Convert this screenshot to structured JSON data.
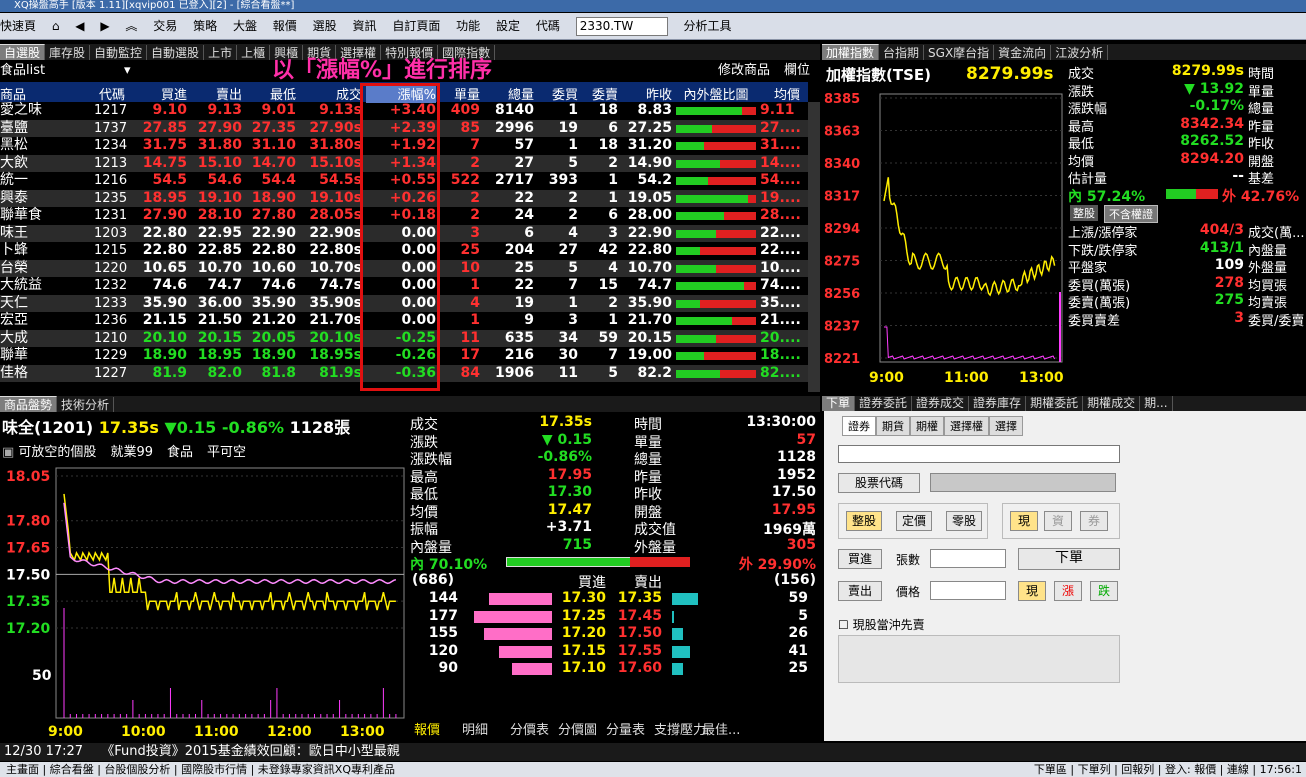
{
  "window": {
    "title": "XQ操盤高手 [版本 1.11][xqvip001 已登入][2] - [綜合看盤**]"
  },
  "toolbar": {
    "items": [
      "快速頁",
      "交易",
      "策略",
      "大盤",
      "報價",
      "選股",
      "資訊",
      "自訂頁面",
      "功能",
      "設定",
      "代碼"
    ],
    "symbol_value": "2330.TW",
    "analysis": "分析工具"
  },
  "watchlist": {
    "tabs": [
      "自選股",
      "庫存股",
      "自動監控",
      "自動選股",
      "上市",
      "上櫃",
      "興櫃",
      "期貨",
      "選擇權",
      "特別報價",
      "國際指數"
    ],
    "list_name": "食品list",
    "edit_label": "修改商品",
    "field_label": "欄位",
    "overlay_text": "以「漲幅%」進行排序",
    "columns": [
      "商品",
      "代碼",
      "買進",
      "賣出",
      "最低",
      "成交",
      "漲幅%",
      "單量",
      "總量",
      "委買",
      "委賣",
      "昨收",
      "內外盤比圖",
      "均價"
    ],
    "rows": [
      {
        "name": "愛之味",
        "code": "1217",
        "bid": "9.10",
        "ask": "9.13",
        "low": "9.01",
        "last": "9.13s",
        "chg": "+3.40",
        "vol": "409",
        "total": "8140",
        "bq": "1",
        "aq": "18",
        "prev": "8.83",
        "avg": "9.11",
        "c": "red",
        "g": 0.82
      },
      {
        "name": "臺鹽",
        "code": "1737",
        "bid": "27.85",
        "ask": "27.90",
        "low": "27.35",
        "last": "27.90s",
        "chg": "+2.39",
        "vol": "85",
        "total": "2996",
        "bq": "19",
        "aq": "6",
        "prev": "27.25",
        "avg": "27....",
        "c": "red",
        "g": 0.45
      },
      {
        "name": "黑松",
        "code": "1234",
        "bid": "31.75",
        "ask": "31.80",
        "low": "31.10",
        "last": "31.80s",
        "chg": "+1.92",
        "vol": "7",
        "total": "57",
        "bq": "1",
        "aq": "18",
        "prev": "31.20",
        "avg": "31....",
        "c": "red",
        "g": 0.35
      },
      {
        "name": "大飲",
        "code": "1213",
        "bid": "14.75",
        "ask": "15.10",
        "low": "14.70",
        "last": "15.10s",
        "chg": "+1.34",
        "vol": "2",
        "total": "27",
        "bq": "5",
        "aq": "2",
        "prev": "14.90",
        "avg": "14....",
        "c": "red",
        "g": 0.55
      },
      {
        "name": "統一",
        "code": "1216",
        "bid": "54.5",
        "ask": "54.6",
        "low": "54.4",
        "last": "54.5s",
        "chg": "+0.55",
        "vol": "522",
        "total": "2717",
        "bq": "393",
        "aq": "1",
        "prev": "54.2",
        "avg": "54....",
        "c": "red",
        "g": 0.4
      },
      {
        "name": "興泰",
        "code": "1235",
        "bid": "18.95",
        "ask": "19.10",
        "low": "18.90",
        "last": "19.10s",
        "chg": "+0.26",
        "vol": "2",
        "total": "22",
        "bq": "2",
        "aq": "1",
        "prev": "19.05",
        "avg": "19....",
        "c": "red",
        "g": 0.9
      },
      {
        "name": "聯華食",
        "code": "1231",
        "bid": "27.90",
        "ask": "28.10",
        "low": "27.80",
        "last": "28.05s",
        "chg": "+0.18",
        "vol": "2",
        "total": "24",
        "bq": "2",
        "aq": "6",
        "prev": "28.00",
        "avg": "28....",
        "c": "red",
        "g": 0.6
      },
      {
        "name": "味王",
        "code": "1203",
        "bid": "22.80",
        "ask": "22.95",
        "low": "22.90",
        "last": "22.90s",
        "chg": "0.00",
        "vol": "3",
        "total": "6",
        "bq": "4",
        "aq": "3",
        "prev": "22.90",
        "avg": "22....",
        "c": "wht",
        "g": 0.5
      },
      {
        "name": "卜蜂",
        "code": "1215",
        "bid": "22.80",
        "ask": "22.85",
        "low": "22.80",
        "last": "22.80s",
        "chg": "0.00",
        "vol": "25",
        "total": "204",
        "bq": "27",
        "aq": "42",
        "prev": "22.80",
        "avg": "22....",
        "c": "wht",
        "g": 0.3
      },
      {
        "name": "台榮",
        "code": "1220",
        "bid": "10.65",
        "ask": "10.70",
        "low": "10.60",
        "last": "10.70s",
        "chg": "0.00",
        "vol": "10",
        "total": "25",
        "bq": "5",
        "aq": "4",
        "prev": "10.70",
        "avg": "10....",
        "c": "wht",
        "g": 0.5
      },
      {
        "name": "大統益",
        "code": "1232",
        "bid": "74.6",
        "ask": "74.7",
        "low": "74.6",
        "last": "74.7s",
        "chg": "0.00",
        "vol": "1",
        "total": "22",
        "bq": "7",
        "aq": "15",
        "prev": "74.7",
        "avg": "74....",
        "c": "wht",
        "g": 0.85
      },
      {
        "name": "天仁",
        "code": "1233",
        "bid": "35.90",
        "ask": "36.00",
        "low": "35.90",
        "last": "35.90s",
        "chg": "0.00",
        "vol": "4",
        "total": "19",
        "bq": "1",
        "aq": "2",
        "prev": "35.90",
        "avg": "35....",
        "c": "wht",
        "g": 0.3
      },
      {
        "name": "宏亞",
        "code": "1236",
        "bid": "21.15",
        "ask": "21.50",
        "low": "21.20",
        "last": "21.70s",
        "chg": "0.00",
        "vol": "1",
        "total": "9",
        "bq": "3",
        "aq": "1",
        "prev": "21.70",
        "avg": "21....",
        "c": "wht",
        "g": 0.7
      },
      {
        "name": "大成",
        "code": "1210",
        "bid": "20.10",
        "ask": "20.15",
        "low": "20.05",
        "last": "20.10s",
        "chg": "-0.25",
        "vol": "11",
        "total": "635",
        "bq": "34",
        "aq": "59",
        "prev": "20.15",
        "avg": "20....",
        "c": "grn",
        "g": 0.5
      },
      {
        "name": "聯華",
        "code": "1229",
        "bid": "18.90",
        "ask": "18.95",
        "low": "18.90",
        "last": "18.95s",
        "chg": "-0.26",
        "vol": "17",
        "total": "216",
        "bq": "30",
        "aq": "7",
        "prev": "19.00",
        "avg": "18....",
        "c": "grn",
        "g": 0.35
      },
      {
        "name": "佳格",
        "code": "1227",
        "bid": "81.9",
        "ask": "82.0",
        "low": "81.8",
        "last": "81.9s",
        "chg": "-0.36",
        "vol": "84",
        "total": "1906",
        "bq": "11",
        "aq": "5",
        "prev": "82.2",
        "avg": "82....",
        "c": "grn",
        "g": 0.55
      }
    ]
  },
  "index_panel": {
    "tabs": [
      "加權指數",
      "台指期",
      "SGX摩台指",
      "資金流向",
      "江波分析"
    ],
    "title": "加權指數(TSE)",
    "value": "8279.99s",
    "labels": [
      "成交",
      "漲跌",
      "漲跌幅",
      "最高",
      "最低",
      "均價",
      "估計量"
    ],
    "values": [
      "8279.99s",
      "▼ 13.92",
      "-0.17%",
      "8342.34",
      "8262.52",
      "8294.20",
      "--"
    ],
    "right_labels": [
      "時間",
      "單量",
      "總量",
      "昨量",
      "昨收",
      "開盤",
      "基差"
    ],
    "in_pct": "內 57.24%",
    "out_pct": "外 42.76%",
    "btn1": "整股",
    "btn2": "不含權證",
    "stats_labels": [
      "上漲/漲停家",
      "下跌/跌停家",
      "平盤家",
      "委買(萬張)",
      "委賣(萬張)",
      "委買賣差"
    ],
    "stats_values": [
      "404/3",
      "413/1",
      "109",
      "278",
      "275",
      "3"
    ],
    "stats_right": [
      "成交(萬...",
      "內盤量",
      "外盤量",
      "均買張",
      "均賣張",
      "委買/委賣"
    ],
    "y_ticks": [
      "8385",
      "8363",
      "8340",
      "8317",
      "8294",
      "8275",
      "8256",
      "8237",
      "8221"
    ],
    "x_ticks": [
      "9:00",
      "11:00",
      "13:00"
    ],
    "bottom_tabs": [
      "報價",
      "明細",
      "分價表",
      "分價圖"
    ]
  },
  "quote_panel": {
    "tabs": [
      "商品盤勢",
      "技術分析"
    ],
    "name": "味全(1201)",
    "price": "17.35s",
    "change": "▼0.15",
    "pct": "-0.86%",
    "lots": "1128張",
    "tags": [
      "可放空的個股",
      "就業99",
      "食品",
      "平可空"
    ],
    "left_labels": [
      "成交",
      "漲跌",
      "漲跌幅",
      "最高",
      "最低",
      "均價",
      "振幅",
      "內盤量"
    ],
    "left_values": [
      "17.35s",
      "▼ 0.15",
      "-0.86%",
      "17.95",
      "17.30",
      "17.47",
      "+3.71",
      "715"
    ],
    "right_labels": [
      "時間",
      "單量",
      "總量",
      "昨量",
      "昨收",
      "開盤",
      "成交值",
      "外盤量"
    ],
    "right_values": [
      "13:30:00",
      "57",
      "1128",
      "1952",
      "17.50",
      "17.95",
      "1969萬",
      "305"
    ],
    "in_pct": "內 70.10%",
    "out_pct": "外 29.90%",
    "bid_total": "(686)",
    "ask_total": "(156)",
    "bid_head": "買進",
    "ask_head": "賣出",
    "book": [
      {
        "bq": "144",
        "bp": "17.30",
        "ap": "17.35",
        "aq": "59"
      },
      {
        "bq": "177",
        "bp": "17.25",
        "ap": "17.45",
        "aq": "5"
      },
      {
        "bq": "155",
        "bp": "17.20",
        "ap": "17.50",
        "aq": "26"
      },
      {
        "bq": "120",
        "bp": "17.15",
        "ap": "17.55",
        "aq": "41"
      },
      {
        "bq": "90",
        "bp": "17.10",
        "ap": "17.60",
        "aq": "25"
      }
    ],
    "y_ticks": [
      "18.05",
      "17.80",
      "17.65",
      "17.50",
      "17.35",
      "17.20",
      "50"
    ],
    "x_ticks": [
      "9:00",
      "10:00",
      "11:00",
      "12:00",
      "13:00"
    ],
    "bottom_tabs": [
      "報價",
      "明細",
      "分價表",
      "分價圖",
      "分量表",
      "支撐壓力",
      "最佳..."
    ]
  },
  "order_panel": {
    "tabs": [
      "下單",
      "證券委託",
      "證券成交",
      "證券庫存",
      "期權委託",
      "期權成交",
      "期..."
    ],
    "subtabs": [
      "證券",
      "期貨",
      "期權",
      "選擇權",
      "選擇"
    ],
    "stock_code": "股票代碼",
    "btn_whole": "整股",
    "btn_fixed": "定價",
    "btn_odd": "零股",
    "btn_cash": "現",
    "btn_margin": "資",
    "btn_short": "券",
    "buy": "買進",
    "sell": "賣出",
    "qty_label": "張數",
    "price_label": "價格",
    "submit": "下單",
    "btn_now": "現",
    "btn_up": "漲",
    "btn_down": "跌",
    "daytrade": "現股當沖先賣"
  },
  "status": {
    "news_time": "12/30 17:27",
    "news": "《Fund投資》2015基金績效回顧：歐日中小型最親",
    "bottom": "主畫面 | 綜合看盤 | 台股個股分析 | 國際股市行情 | 未登錄專家資訊XQ專利產品",
    "right": "下單區 | 下單列 | 回報列 | 登入: 報價 | 連線 | 17:56:1"
  }
}
